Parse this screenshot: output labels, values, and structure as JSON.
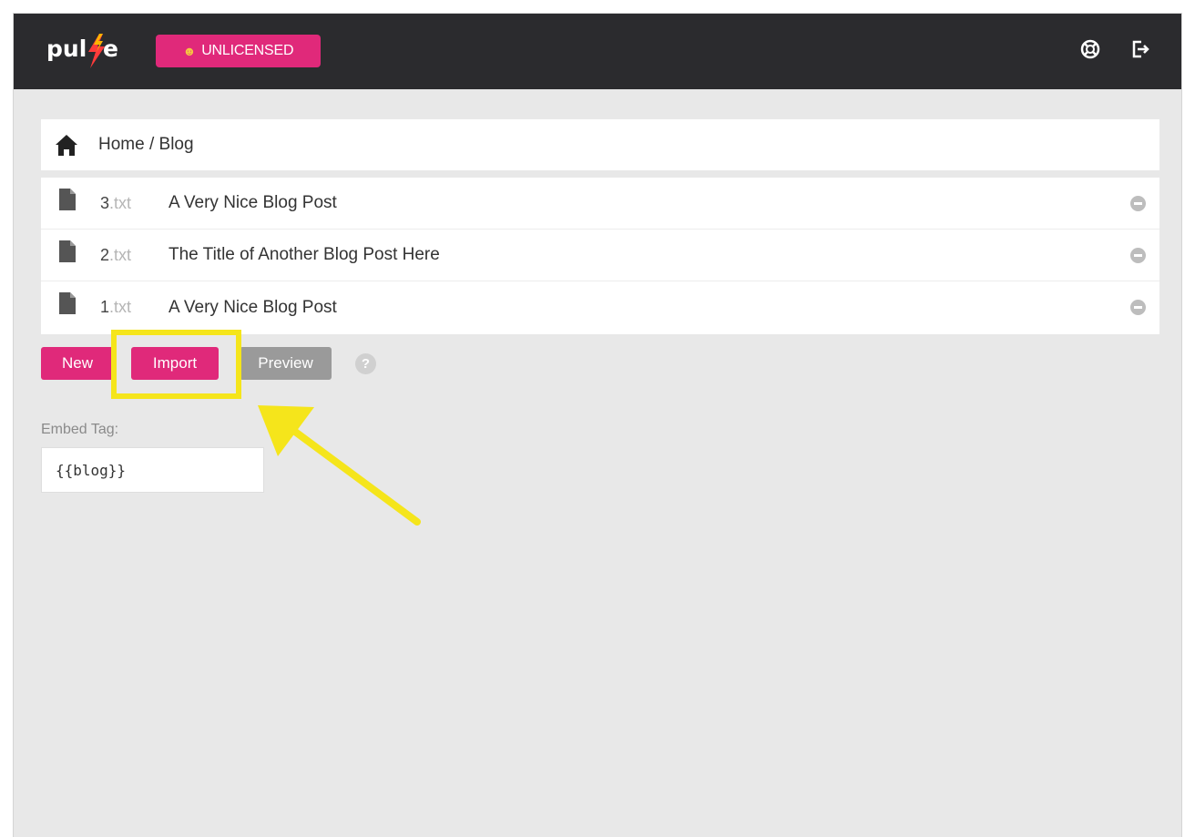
{
  "header": {
    "logo_text": "pulse",
    "license_badge": "UNLICENSED",
    "license_badge_icon": "scream-emoji-icon",
    "icons": [
      "lifebuoy-icon",
      "logout-icon"
    ]
  },
  "breadcrumb": {
    "icon": "home-icon",
    "path": "Home / Blog"
  },
  "files": [
    {
      "number": "3",
      "ext": ".txt",
      "title": "A Very Nice Blog Post"
    },
    {
      "number": "2",
      "ext": ".txt",
      "title": "The Title of Another Blog Post Here"
    },
    {
      "number": "1",
      "ext": ".txt",
      "title": "A Very Nice Blog Post"
    }
  ],
  "actions": {
    "new_label": "New",
    "import_label": "Import",
    "preview_label": "Preview",
    "help_label": "?"
  },
  "embed": {
    "label": "Embed Tag:",
    "value": "{{blog}}"
  },
  "colors": {
    "accent": "#e0297a",
    "topbar": "#2b2b2e",
    "highlight": "#f5e51b",
    "preview_button": "#9a9a9a"
  }
}
